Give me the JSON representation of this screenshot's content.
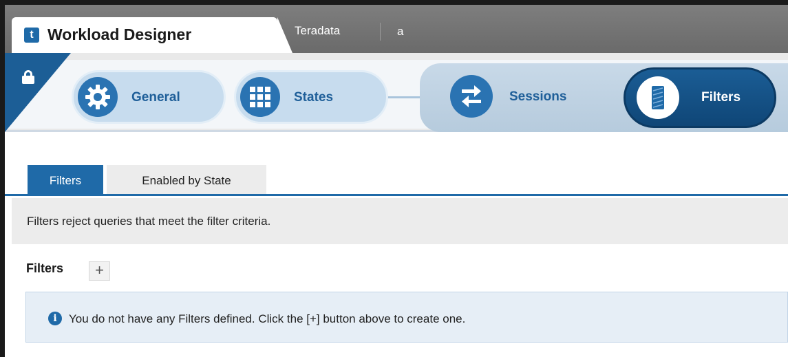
{
  "app": {
    "logo_glyph": "t",
    "title": "Workload Designer"
  },
  "system": {
    "name": "Teradata",
    "user": "a"
  },
  "steps": [
    {
      "label": "General",
      "icon": "gear-icon",
      "state": "inactive"
    },
    {
      "label": "States",
      "icon": "grid-icon",
      "state": "inactive"
    },
    {
      "label": "Sessions",
      "icon": "transfer-arrows-icon",
      "state": "inactive"
    },
    {
      "label": "Filters",
      "icon": "filter-card-icon",
      "state": "active"
    }
  ],
  "tabs": [
    {
      "label": "Filters",
      "active": true
    },
    {
      "label": "Enabled by State",
      "active": false
    }
  ],
  "description": "Filters reject queries that meet the filter criteria.",
  "section": {
    "title": "Filters",
    "add_label": "+"
  },
  "info": {
    "icon_glyph": "i",
    "message": "You do not have any Filters defined. Click the [+] button above to create one."
  },
  "colors": {
    "accent": "#1f6aa8",
    "active_step": "#1b5d95",
    "titlebar": "#737373"
  }
}
